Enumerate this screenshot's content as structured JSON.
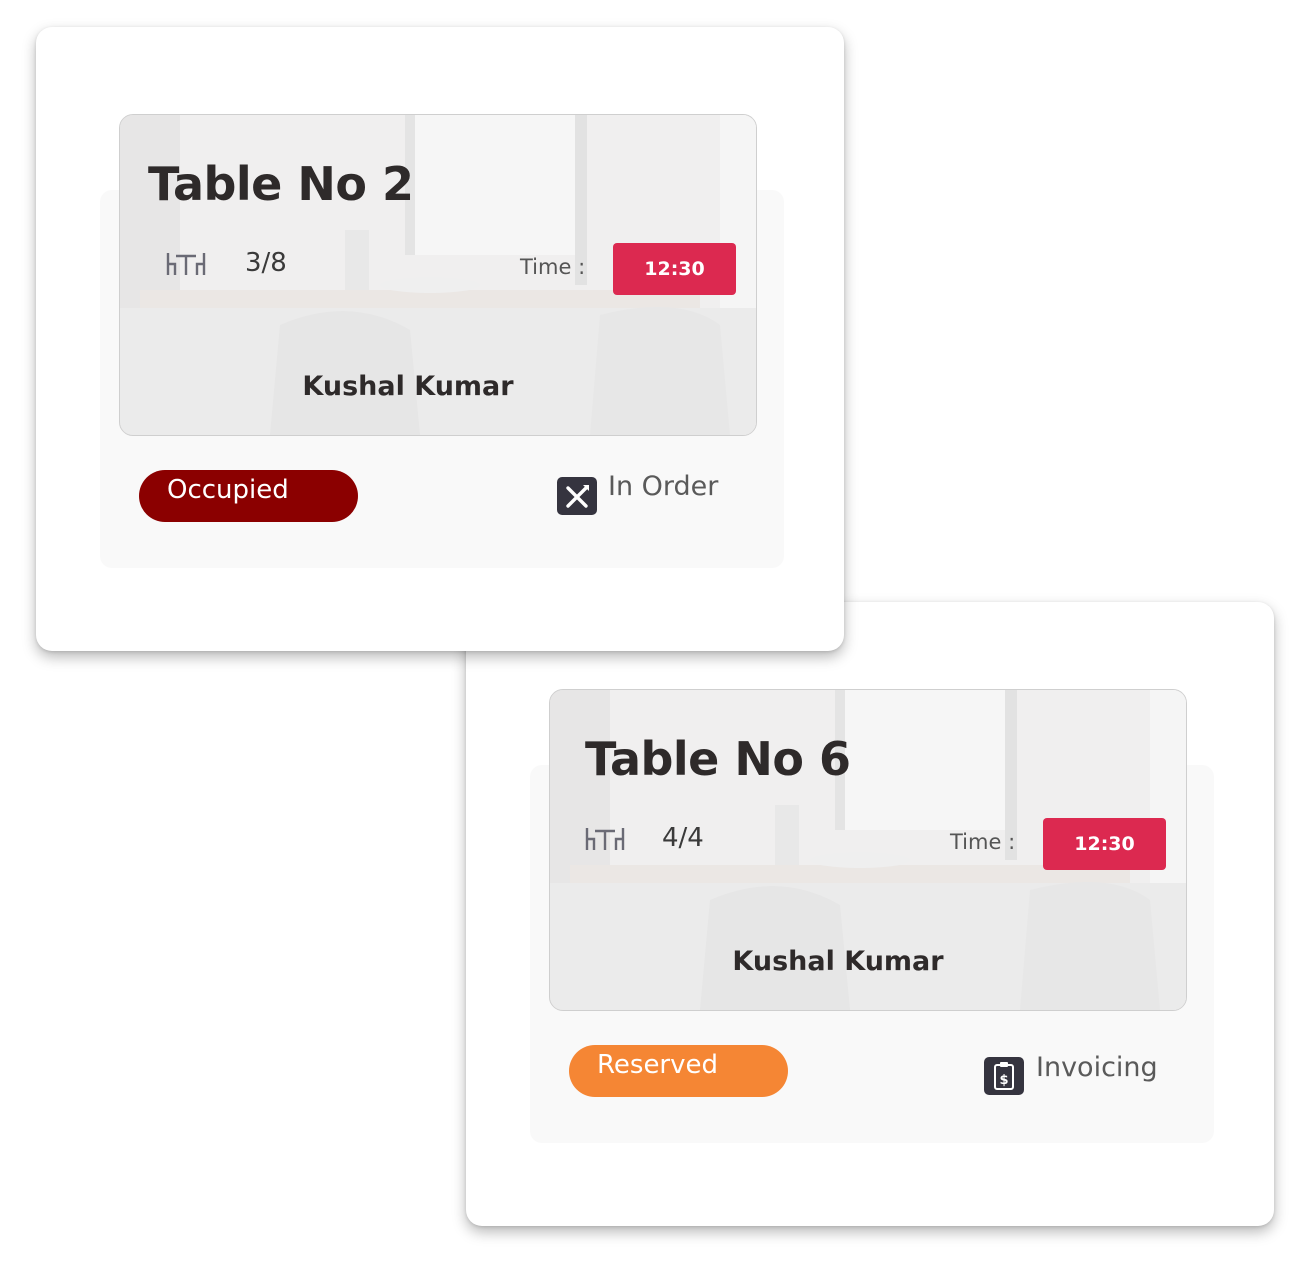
{
  "colors": {
    "time_chip": "#dc2950",
    "occupied": "#8b0000",
    "reserved": "#f58634",
    "icon_badge": "#35343f"
  },
  "tables": [
    {
      "title": "Table No 2",
      "seats": "3/8",
      "time_label": "Time :",
      "time": "12:30",
      "customer": "Kushal Kumar",
      "status": "Occupied",
      "status_color": "#8b0000",
      "order_state": "In Order",
      "order_icon": "fork-knife-icon"
    },
    {
      "title": "Table No 6",
      "seats": "4/4",
      "time_label": "Time :",
      "time": "12:30",
      "customer": "Kushal Kumar",
      "status": "Reserved",
      "status_color": "#f58634",
      "order_state": "Invoicing",
      "order_icon": "invoice-icon"
    }
  ]
}
